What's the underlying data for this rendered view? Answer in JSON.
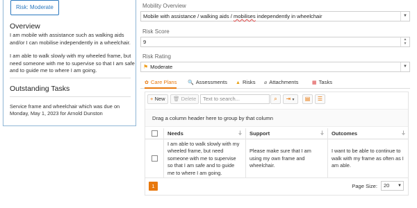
{
  "risk_badge": "Risk: Moderate",
  "overview": {
    "heading": "Overview",
    "paragraph1": "I am mobile with assistance such as walking aids and/or I can mobilise independently in a wheelchair.",
    "paragraph2": "I am able to walk slowly with my wheeled frame, but need someone with me to supervise so that I am safe and to guide me to where I am going."
  },
  "outstanding_tasks": {
    "heading": "Outstanding Tasks",
    "text": "Service frame and wheelchair which was due on Monday, May 1, 2023 for Arnold Dunston"
  },
  "form": {
    "mobility_label": "Mobility Overview",
    "mobility_value_pre": "Mobile with assistance / walking aids / ",
    "mobility_value_spell": "mobilises",
    "mobility_value_post": " independently in wheelchair",
    "score_label": "Risk Score",
    "score_value": "9",
    "rating_label": "Risk Rating",
    "rating_value": "Moderate"
  },
  "tabs": [
    {
      "label": "Care Plans",
      "icon": "care-plans-icon"
    },
    {
      "label": "Assessments",
      "icon": "assessments-icon"
    },
    {
      "label": "Risks",
      "icon": "warning-icon"
    },
    {
      "label": "Attachments",
      "icon": "paperclip-icon"
    },
    {
      "label": "Tasks",
      "icon": "calendar-icon"
    }
  ],
  "toolbar": {
    "new_label": "New",
    "delete_label": "Delete",
    "search_placeholder": "Text to search..."
  },
  "group_hint": "Drag a column header here to group by that column",
  "columns": [
    "Needs",
    "Support",
    "Outcomes"
  ],
  "rows": [
    {
      "needs": "I am able to walk slowly with my wheeled frame, but need someone with me to supervise so that I am safe and to guide me to where I am going.",
      "support": "Please make sure that I am using my own frame and wheelchair.",
      "outcomes": "I want to be able to continue to walk with my frame as often as I am able."
    }
  ],
  "pager": {
    "current_page": "1",
    "size_label": "Page Size:",
    "size_value": "20"
  },
  "colors": {
    "accent": "#e8780c",
    "link_blue": "#2a78bf"
  }
}
